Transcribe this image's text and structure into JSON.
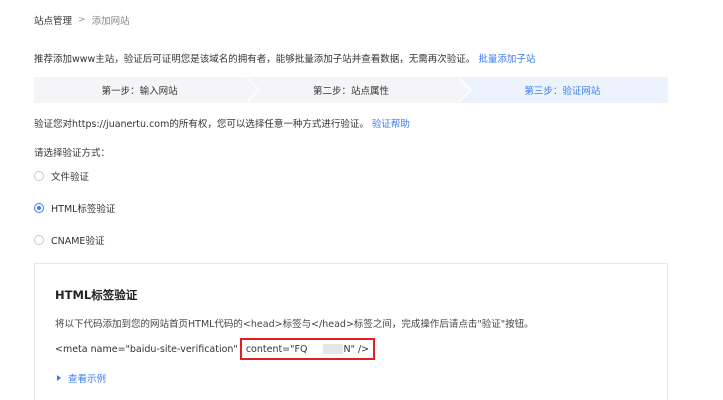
{
  "breadcrumb": {
    "home": "站点管理",
    "separator": ">",
    "current": "添加网站"
  },
  "intro": {
    "text": "推荐添加www主站，验证后可证明您是该域名的拥有者，能够批量添加子站并查看数据，无需再次验证。",
    "link": "批量添加子站"
  },
  "steps": [
    {
      "label": "第一步：输入网站",
      "active": false
    },
    {
      "label": "第二步：站点属性",
      "active": false
    },
    {
      "label": "第三步：验证网站",
      "active": true
    }
  ],
  "verify": {
    "text": "验证您对https://juanertu.com的所有权，您可以选择任意一种方式进行验证。",
    "help_link": "验证帮助"
  },
  "choose_label": "请选择验证方式：",
  "methods": [
    {
      "label": "文件验证",
      "checked": false
    },
    {
      "label": "HTML标签验证",
      "checked": true
    },
    {
      "label": "CNAME验证",
      "checked": false
    }
  ],
  "panel": {
    "title": "HTML标签验证",
    "desc": "将以下代码添加到您的网站首页HTML代码的<head>标签与</head>标签之间，完成操作后请点击\"验证\"按钮。",
    "code_prefix": "<meta name=\"baidu-site-verification\"",
    "code_content_start": "content=\"FQ",
    "code_content_end": "N\" />",
    "example_link": "查看示例"
  },
  "colors": {
    "accent": "#3a7cf0",
    "highlight_border": "#e02020",
    "step_bg": "#f5f5f7",
    "step_active_bg": "#edf3fd"
  }
}
